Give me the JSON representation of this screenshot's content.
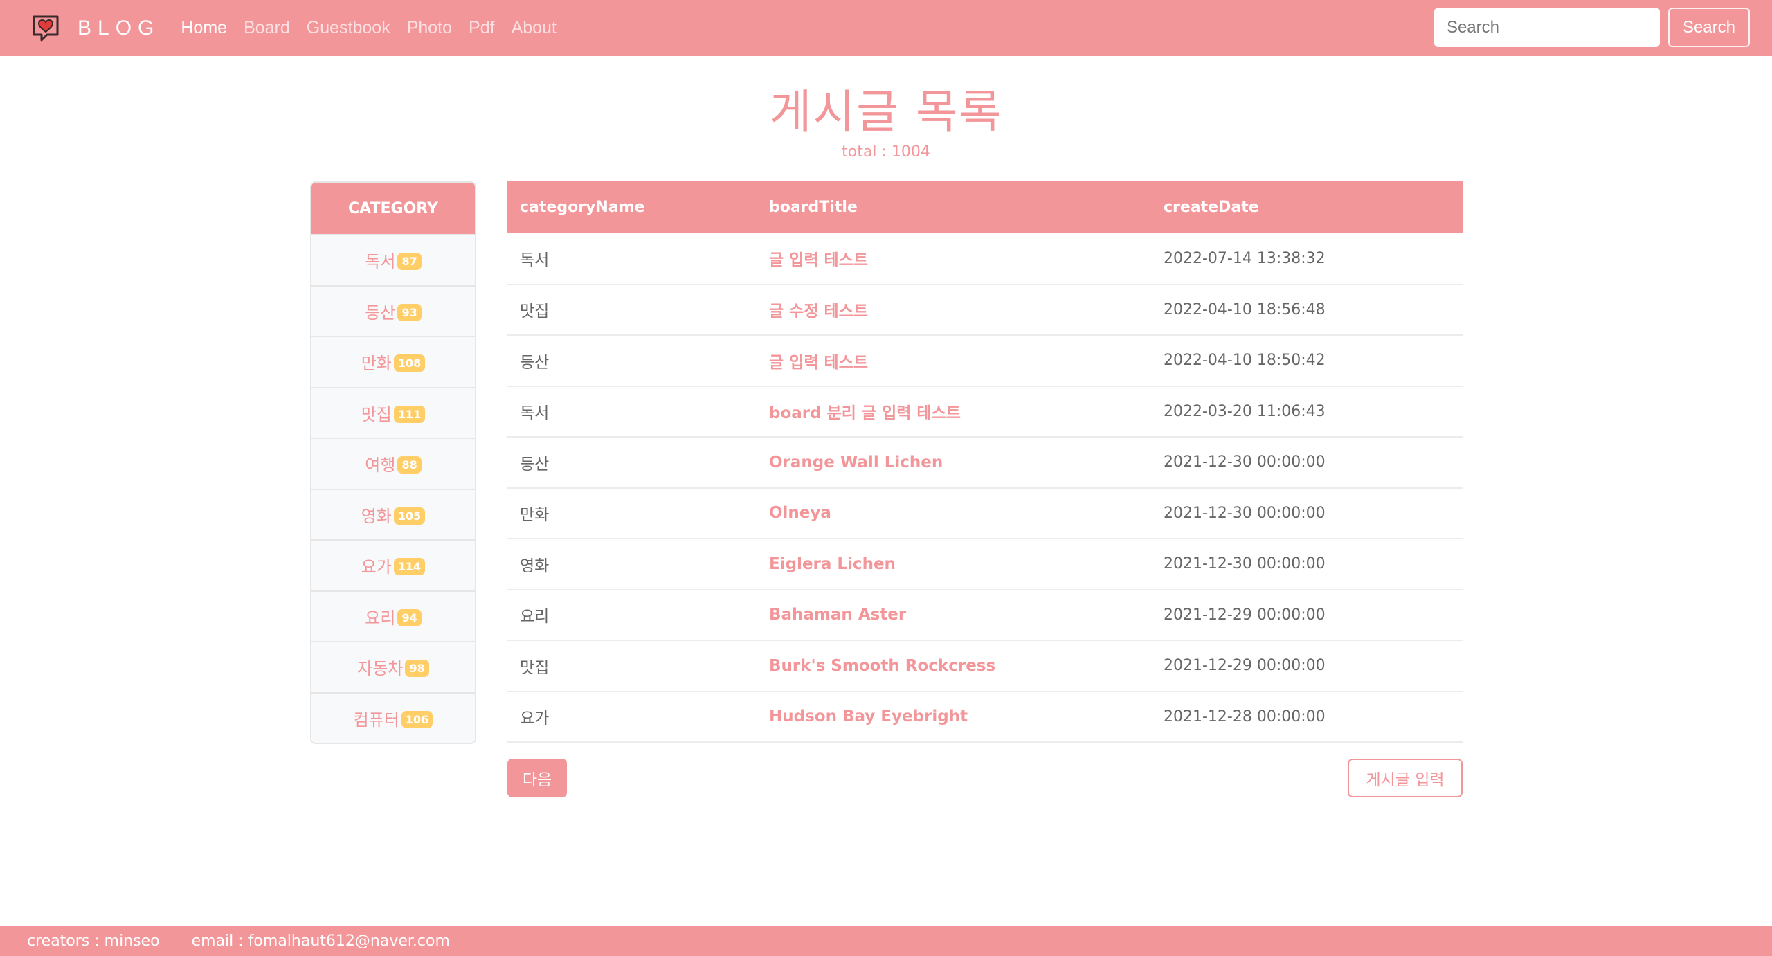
{
  "navbar": {
    "brand": "BLOG",
    "links": [
      "Home",
      "Board",
      "Guestbook",
      "Photo",
      "Pdf",
      "About"
    ],
    "search_placeholder": "Search",
    "search_button": "Search"
  },
  "page": {
    "title": "게시글 목록",
    "total": "total : 1004"
  },
  "category": {
    "header": "CATEGORY",
    "items": [
      {
        "name": "독서",
        "count": "87"
      },
      {
        "name": "등산",
        "count": "93"
      },
      {
        "name": "만화",
        "count": "108"
      },
      {
        "name": "맛집",
        "count": "111"
      },
      {
        "name": "여행",
        "count": "88"
      },
      {
        "name": "영화",
        "count": "105"
      },
      {
        "name": "요가",
        "count": "114"
      },
      {
        "name": "요리",
        "count": "94"
      },
      {
        "name": "자동차",
        "count": "98"
      },
      {
        "name": "컴퓨터",
        "count": "106"
      }
    ]
  },
  "table": {
    "headers": [
      "categoryName",
      "boardTitle",
      "createDate"
    ],
    "rows": [
      {
        "category": "독서",
        "title": "글 입력 테스트",
        "date": "2022-07-14 13:38:32"
      },
      {
        "category": "맛집",
        "title": "글 수정 테스트",
        "date": "2022-04-10 18:56:48"
      },
      {
        "category": "등산",
        "title": "글 입력 테스트",
        "date": "2022-04-10 18:50:42"
      },
      {
        "category": "독서",
        "title": "board 분리 글 입력 테스트",
        "date": "2022-03-20 11:06:43"
      },
      {
        "category": "등산",
        "title": "Orange Wall Lichen",
        "date": "2021-12-30 00:00:00"
      },
      {
        "category": "만화",
        "title": "Olneya",
        "date": "2021-12-30 00:00:00"
      },
      {
        "category": "영화",
        "title": "Eiglera Lichen",
        "date": "2021-12-30 00:00:00"
      },
      {
        "category": "요리",
        "title": "Bahaman Aster",
        "date": "2021-12-29 00:00:00"
      },
      {
        "category": "맛집",
        "title": "Burk's Smooth Rockcress",
        "date": "2021-12-29 00:00:00"
      },
      {
        "category": "요가",
        "title": "Hudson Bay Eyebright",
        "date": "2021-12-28 00:00:00"
      }
    ]
  },
  "actions": {
    "next": "다음",
    "write": "게시글 입력"
  },
  "footer": {
    "creators": "creators : minseo",
    "email": "email : fomalhaut612@naver.com"
  },
  "colors": {
    "accent": "#f3969a",
    "badge": "#ffce67"
  },
  "icons": {
    "brand": "heart-chat-icon"
  }
}
